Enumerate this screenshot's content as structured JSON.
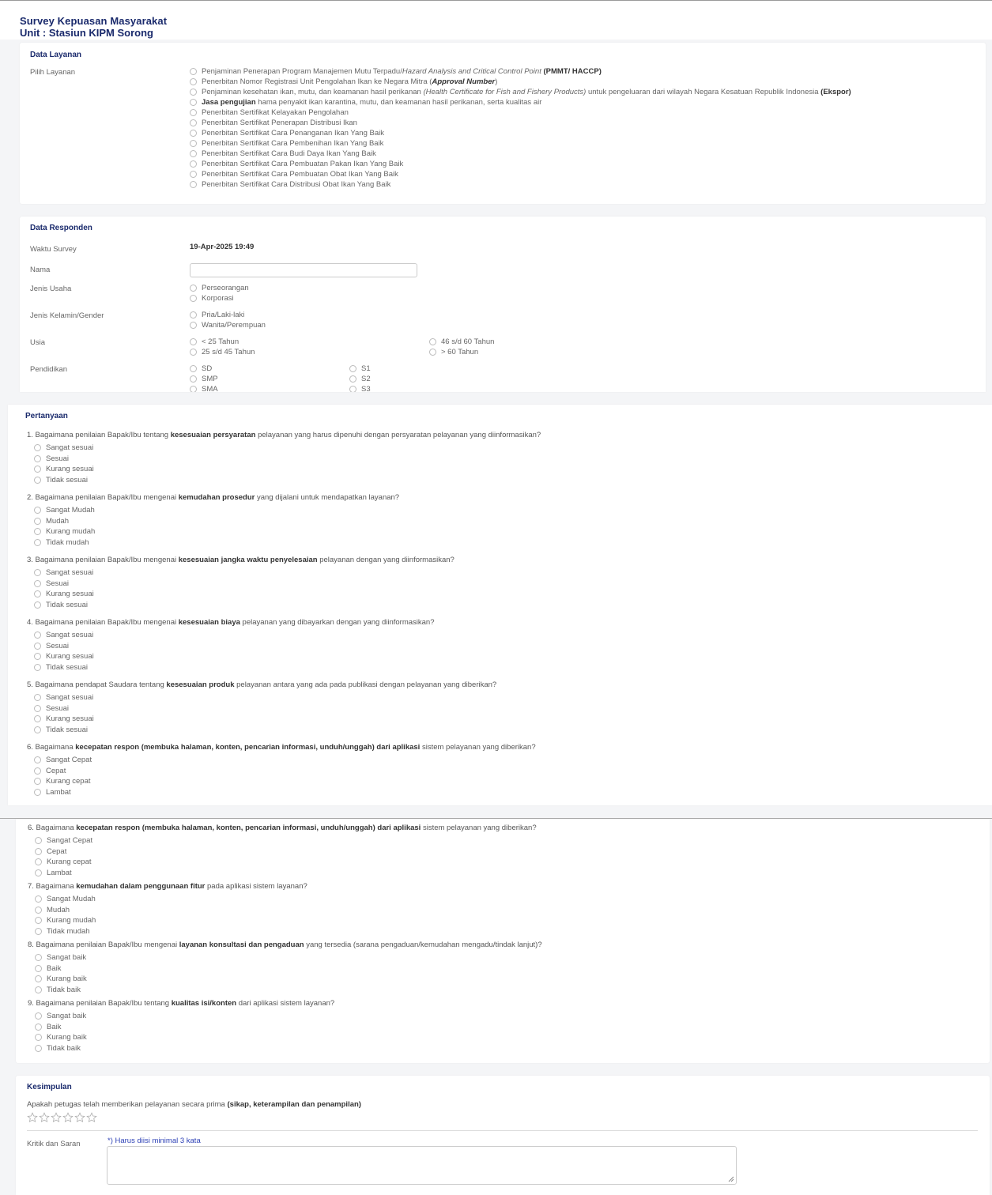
{
  "header": {
    "title": "Survey Kepuasan Masyarakat",
    "unit": "Unit : Stasiun KIPM Sorong"
  },
  "layanan": {
    "section_title": "Data Layanan",
    "label": "Pilih Layanan",
    "options": [
      {
        "pre": "Penjaminan Penerapan Program Manajemen Mutu Terpadu/",
        "it": "Hazard Analysis and Critical Control Point",
        "mid": " ",
        "b": "(PMMT/ HACCP)",
        "post": ""
      },
      {
        "pre": "Penerbitan Nomor Registrasi Unit Pengolahan Ikan ke Negara Mitra (",
        "bi": "Approval Number",
        "post2": ")"
      },
      {
        "pre": "Penjaminan kesehatan ikan, mutu, dan keamanan hasil perikanan ",
        "it": "(Health Certificate for Fish and Fishery Products)",
        "mid": " untuk pengeluaran dari wilayah Negara Kesatuan Republik Indonesia ",
        "b": "(Ekspor)",
        "post": ""
      },
      {
        "b0": "Jasa pengujian",
        "pre": " hama penyakit ikan karantina, mutu, dan keamanan hasil perikanan, serta kualitas air"
      },
      {
        "pre": "Penerbitan Sertifikat Kelayakan Pengolahan"
      },
      {
        "pre": "Penerbitan Sertifikat Penerapan Distribusi Ikan"
      },
      {
        "pre": "Penerbitan Sertifikat Cara Penanganan Ikan Yang Baik"
      },
      {
        "pre": "Penerbitan Sertifikat Cara Pembenihan Ikan Yang Baik"
      },
      {
        "pre": "Penerbitan Sertifikat Cara Budi Daya Ikan Yang Baik"
      },
      {
        "pre": "Penerbitan Sertifikat Cara Pembuatan Pakan Ikan Yang Baik"
      },
      {
        "pre": "Penerbitan Sertifikat Cara Pembuatan Obat Ikan Yang Baik"
      },
      {
        "pre": "Penerbitan Sertifikat Cara Distribusi Obat Ikan Yang Baik"
      }
    ]
  },
  "responden": {
    "section_title": "Data Responden",
    "waktu_label": "Waktu Survey",
    "waktu_value": "19-Apr-2025 19:49",
    "nama_label": "Nama",
    "nama_value": "",
    "usaha_label": "Jenis Usaha",
    "usaha_options": [
      "Perseorangan",
      "Korporasi"
    ],
    "gender_label": "Jenis Kelamin/Gender",
    "gender_options": [
      "Pria/Laki-laki",
      "Wanita/Perempuan"
    ],
    "usia_label": "Usia",
    "usia_options": [
      "< 25 Tahun",
      "25 s/d 45 Tahun",
      "46 s/d 60 Tahun",
      "> 60 Tahun"
    ],
    "pendidikan_label": "Pendidikan",
    "pendidikan_options": [
      "SD",
      "SMP",
      "SMA",
      "S1",
      "S2",
      "S3"
    ]
  },
  "pertanyaan": {
    "section_title": "Pertanyaan",
    "questions": [
      {
        "pre": "1. Bagaimana penilaian Bapak/Ibu tentang ",
        "b": "kesesuaian persyaratan",
        "post": " pelayanan yang harus dipenuhi dengan persyaratan pelayanan yang diinformasikan?",
        "options": [
          "Sangat sesuai",
          "Sesuai",
          "Kurang sesuai",
          "Tidak sesuai"
        ]
      },
      {
        "pre": "2. Bagaimana penilaian Bapak/Ibu mengenai ",
        "b": "kemudahan prosedur",
        "post": " yang dijalani untuk mendapatkan layanan?",
        "options": [
          "Sangat Mudah",
          "Mudah",
          "Kurang mudah",
          "Tidak mudah"
        ]
      },
      {
        "pre": "3. Bagaimana penilaian Bapak/Ibu mengenai ",
        "b": "kesesuaian jangka waktu penyelesaian",
        "post": " pelayanan dengan yang diinformasikan?",
        "options": [
          "Sangat sesuai",
          "Sesuai",
          "Kurang sesuai",
          "Tidak sesuai"
        ]
      },
      {
        "pre": "4. Bagaimana penilaian Bapak/Ibu mengenai ",
        "b": "kesesuaian biaya",
        "post": " pelayanan yang dibayarkan dengan yang diinformasikan?",
        "options": [
          "Sangat sesuai",
          "Sesuai",
          "Kurang sesuai",
          "Tidak sesuai"
        ]
      },
      {
        "pre": "5. Bagaimana pendapat Saudara tentang ",
        "b": "kesesuaian produk",
        "post": " pelayanan antara yang ada pada publikasi dengan pelayanan yang diberikan?",
        "options": [
          "Sangat sesuai",
          "Sesuai",
          "Kurang sesuai",
          "Tidak sesuai"
        ]
      },
      {
        "pre": "6. Bagaimana ",
        "b": "kecepatan respon (membuka halaman, konten, pencarian informasi, unduh/unggah) dari aplikasi",
        "post": " sistem pelayanan yang diberikan?",
        "options": [
          "Sangat Cepat",
          "Cepat",
          "Kurang cepat",
          "Lambat"
        ]
      }
    ],
    "questions_b": [
      {
        "pre": "6. Bagaimana ",
        "b": "kecepatan respon (membuka halaman, konten, pencarian informasi, unduh/unggah) dari aplikasi",
        "post": " sistem pelayanan yang diberikan?",
        "options": [
          "Sangat Cepat",
          "Cepat",
          "Kurang cepat",
          "Lambat"
        ]
      },
      {
        "pre": "7. Bagaimana ",
        "b": "kemudahan dalam penggunaan fitur",
        "post": " pada aplikasi sistem layanan?",
        "options": [
          "Sangat Mudah",
          "Mudah",
          "Kurang mudah",
          "Tidak mudah"
        ]
      },
      {
        "pre": "8. Bagaimana penilaian Bapak/Ibu mengenai ",
        "b": "layanan konsultasi dan pengaduan",
        "post": " yang tersedia (sarana pengaduan/kemudahan mengadu/tindak lanjut)?",
        "options": [
          "Sangat baik",
          "Baik",
          "Kurang baik",
          "Tidak baik"
        ]
      },
      {
        "pre": "9. Bagaimana penilaian Bapak/Ibu tentang ",
        "b": "kualitas isi/konten",
        "post": " dari aplikasi sistem layanan?",
        "options": [
          "Sangat baik",
          "Baik",
          "Kurang baik",
          "Tidak baik"
        ]
      }
    ]
  },
  "kesimpulan": {
    "section_title": "Kesimpulan",
    "prima_pre": "Apakah petugas telah memberikan pelayanan secara prima ",
    "prima_b": "(sikap, keterampilan dan penampilan)",
    "prima_post": "",
    "rating": 0,
    "rating_max": 6,
    "kritik_label": "Kritik dan Saran",
    "kritik_hint": "*) Harus diisi minimal 3 kata",
    "kritik_value": ""
  },
  "colors": {
    "accent": "#1a2a6c",
    "hint": "#2b3fb5"
  }
}
